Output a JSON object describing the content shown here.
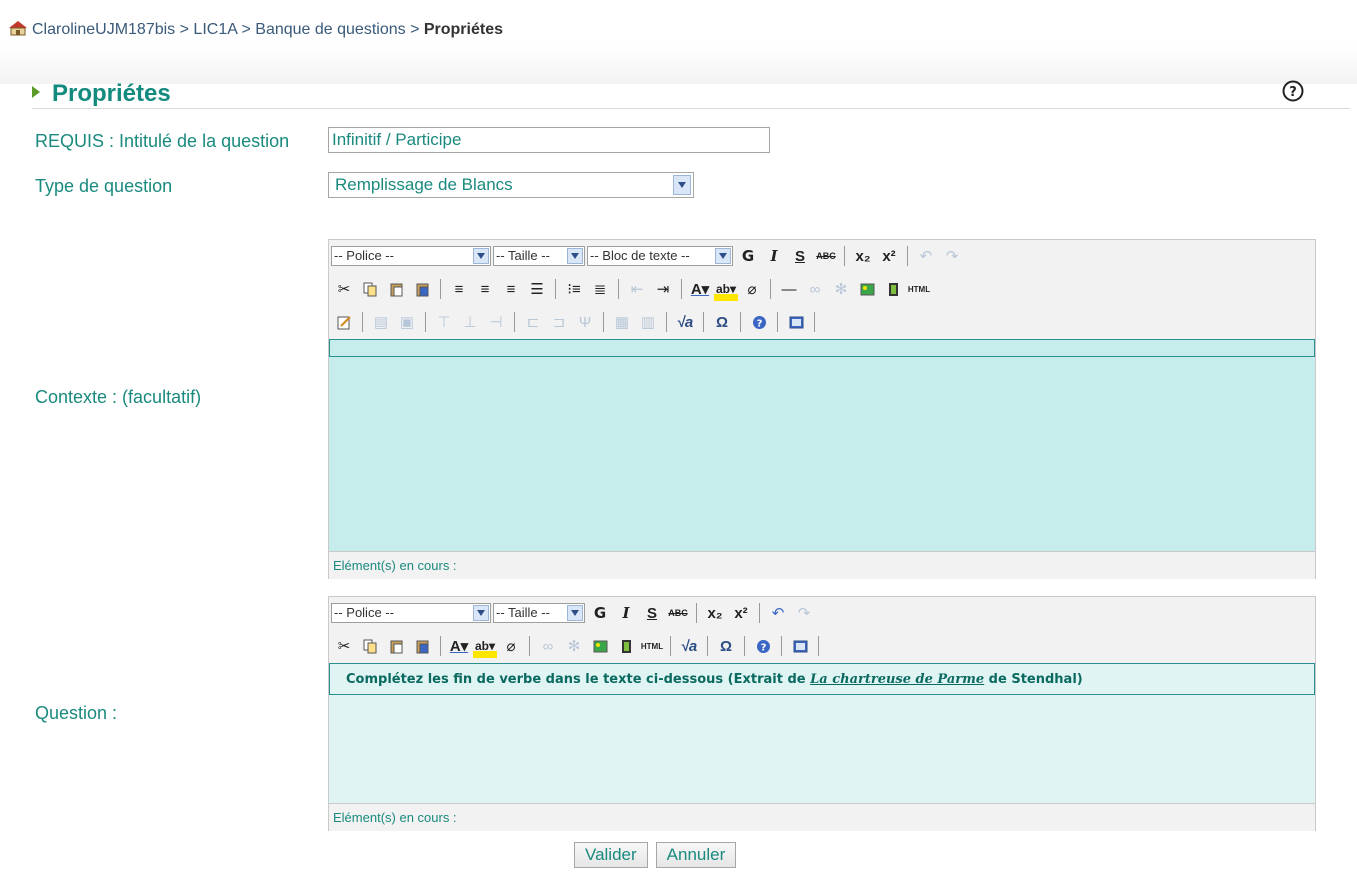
{
  "breadcrumb": {
    "items": [
      "ClarolineUJM187bis",
      "LIC1A",
      "Banque de questions"
    ],
    "separator": ">",
    "current": "Propriétes"
  },
  "page": {
    "title": "Propriétes"
  },
  "form": {
    "title_label": "REQUIS : Intitulé de la question",
    "title_value": "Infinitif / Participe",
    "type_label": "Type de question",
    "type_value": "Remplissage de Blancs",
    "context_label": "Contexte : (facultatif)",
    "question_label": "Question :"
  },
  "editor1": {
    "font_select": "-- Police --",
    "size_select": "-- Taille --",
    "block_select": "-- Bloc de texte --",
    "bold": "G",
    "italic": "I",
    "underline": "S",
    "strike": "ABC",
    "status": "Elément(s) en cours :"
  },
  "editor2": {
    "font_select": "-- Police --",
    "size_select": "-- Taille --",
    "bold": "G",
    "italic": "I",
    "underline": "S",
    "strike": "ABC",
    "content_pre": "Complétez les fin de verbe dans le texte ci-dessous (Extrait de ",
    "content_title": "La chartreuse de Parme",
    "content_post": " de Stendhal)",
    "status": "Elément(s) en cours :"
  },
  "buttons": {
    "submit": "Valider",
    "cancel": "Annuler"
  },
  "colors": {
    "accent": "#128a7e",
    "editor_bg": "#c7ecec",
    "triangle": "#5b9c28"
  }
}
